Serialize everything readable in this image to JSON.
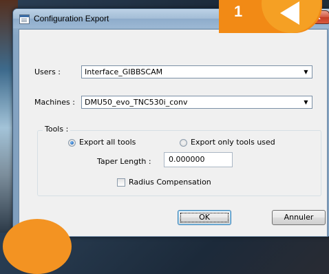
{
  "window": {
    "title": "Configuration Export",
    "close_label": "x"
  },
  "users": {
    "label": "Users :",
    "value": "Interface_GIBBSCAM"
  },
  "machines": {
    "label": "Machines :",
    "value": "DMU50_evo_TNC530i_conv"
  },
  "tools": {
    "group_label": "Tools :",
    "export_all_label": "Export all tools",
    "export_used_label": "Export only tools used",
    "export_all_checked": true,
    "taper_label": "Taper Length :",
    "taper_value": "0.000000",
    "radius_label": "Radius Compensation",
    "radius_checked": false
  },
  "buttons": {
    "ok_label": "OK",
    "cancel_label": "Annuler"
  },
  "annotation": {
    "step_number": "1",
    "accent_color": "#f28a15"
  },
  "icons": {
    "dropdown": "chevron-down-icon",
    "window": "window-icon",
    "pointer": "arrow-left-icon"
  }
}
